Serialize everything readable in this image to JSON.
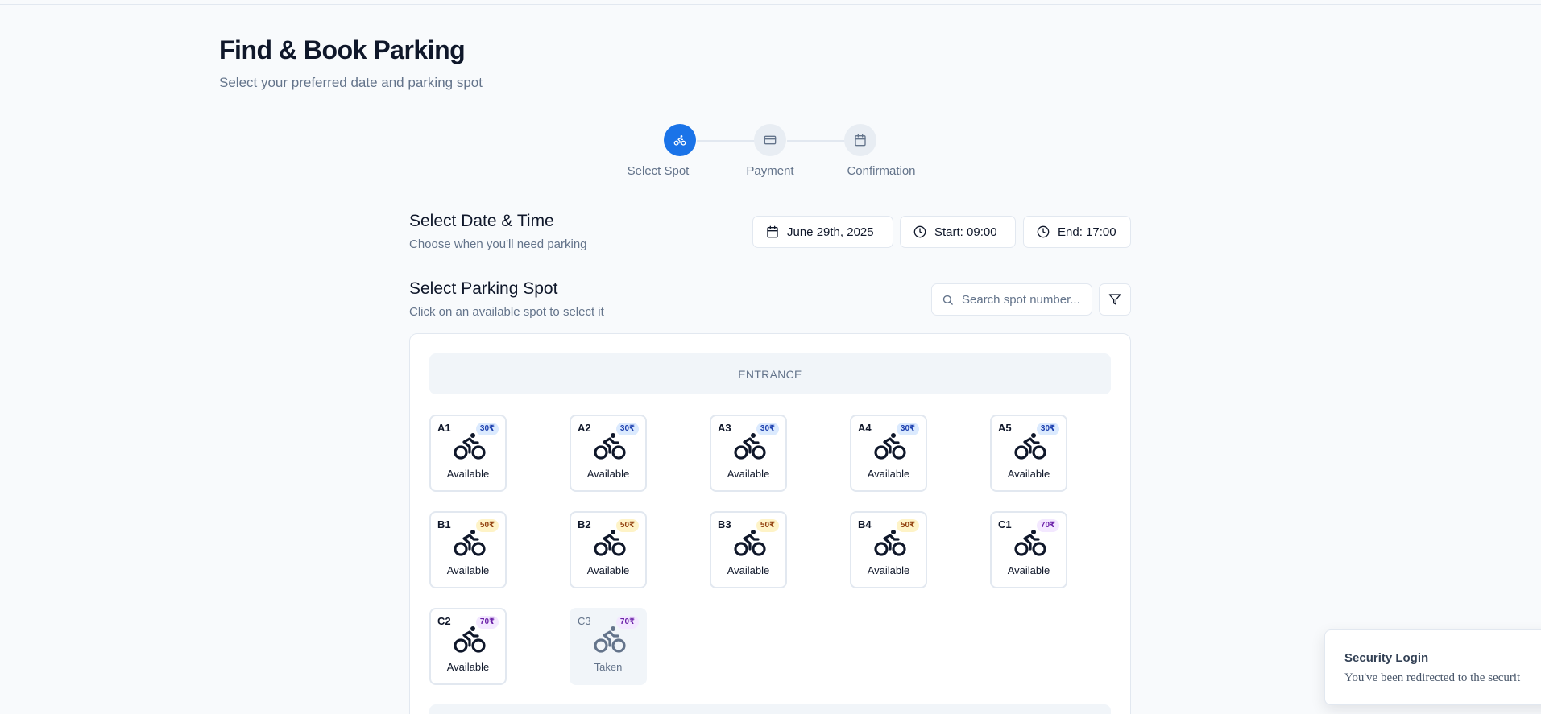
{
  "header": {
    "title": "Find & Book Parking",
    "subtitle": "Select your preferred date and parking spot"
  },
  "stepper": {
    "active_color": "#1a73e8",
    "steps": [
      {
        "label": "Select Spot",
        "icon": "bike-icon",
        "active": true
      },
      {
        "label": "Payment",
        "icon": "credit-card-icon",
        "active": false
      },
      {
        "label": "Confirmation",
        "icon": "calendar-icon",
        "active": false
      }
    ]
  },
  "datetime": {
    "title": "Select Date & Time",
    "subtitle": "Choose when you'll need parking",
    "date_label": "June 29th, 2025",
    "start_label": "Start: 09:00",
    "end_label": "End: 17:00"
  },
  "spot_section": {
    "title": "Select Parking Spot",
    "subtitle": "Click on an available spot to select it",
    "search_placeholder": "Search spot number..."
  },
  "map": {
    "entrance_label": "ENTRANCE",
    "spots": [
      {
        "id": "A1",
        "price": "30₹",
        "tier": "t30",
        "status": "Available"
      },
      {
        "id": "A2",
        "price": "30₹",
        "tier": "t30",
        "status": "Available"
      },
      {
        "id": "A3",
        "price": "30₹",
        "tier": "t30",
        "status": "Available"
      },
      {
        "id": "A4",
        "price": "30₹",
        "tier": "t30",
        "status": "Available"
      },
      {
        "id": "A5",
        "price": "30₹",
        "tier": "t30",
        "status": "Available"
      },
      {
        "id": "B1",
        "price": "50₹",
        "tier": "t50",
        "status": "Available"
      },
      {
        "id": "B2",
        "price": "50₹",
        "tier": "t50",
        "status": "Available"
      },
      {
        "id": "B3",
        "price": "50₹",
        "tier": "t50",
        "status": "Available"
      },
      {
        "id": "B4",
        "price": "50₹",
        "tier": "t50",
        "status": "Available"
      },
      {
        "id": "C1",
        "price": "70₹",
        "tier": "t70",
        "status": "Available"
      },
      {
        "id": "C2",
        "price": "70₹",
        "tier": "t70",
        "status": "Available"
      },
      {
        "id": "C3",
        "price": "70₹",
        "tier": "t70",
        "status": "Taken"
      }
    ]
  },
  "toast": {
    "title": "Security Login",
    "body": "You've been redirected to the securit"
  }
}
